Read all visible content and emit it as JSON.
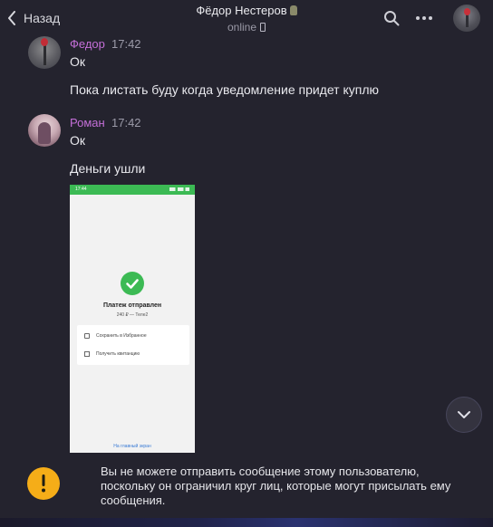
{
  "header": {
    "back_label": "Назад",
    "chat_title": "Фёдор Нестеров",
    "status": "online"
  },
  "messages": [
    {
      "sender": "Федор",
      "time": "17:42",
      "lines": [
        "Ок",
        "Пока листать буду когда уведомление придет куплю"
      ]
    },
    {
      "sender": "Роман",
      "time": "17:42",
      "lines": [
        "Ок",
        "Деньги ушли"
      ],
      "attachment": {
        "status_time": "17:44",
        "title": "Платеж отправлен",
        "amount": "240 ₽ — Теле2",
        "options": [
          "Сохранить в Избранное",
          "Получить квитанцию"
        ],
        "footer": "На главный экран"
      }
    }
  ],
  "notice": {
    "text": "Вы не можете отправить сообщение этому пользователю, поскольку он ограничил круг лиц, которые могут присылать ему сообщения."
  },
  "colors": {
    "background": "#24232e",
    "sender_name": "#c46fd8",
    "warning": "#f5ad18",
    "success": "#3cba54"
  }
}
